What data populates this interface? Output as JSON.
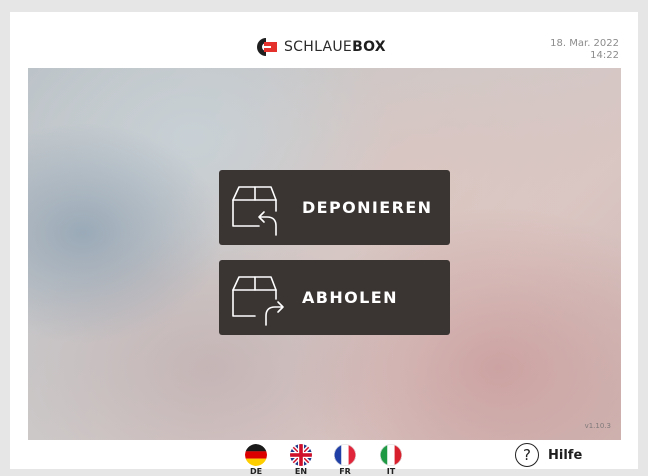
{
  "header": {
    "brand_prefix": "SCHLAUE",
    "brand_suffix": "BOX",
    "date": "18. Mar. 2022",
    "time": "14:22"
  },
  "actions": {
    "deposit_label": "DEPONIEREN",
    "pickup_label": "ABHOLEN"
  },
  "version": "v1.10.3",
  "languages": [
    {
      "code": "DE",
      "flag_icon": "germany-flag-icon"
    },
    {
      "code": "EN",
      "flag_icon": "uk-flag-icon"
    },
    {
      "code": "FR",
      "flag_icon": "france-flag-icon"
    },
    {
      "code": "IT",
      "flag_icon": "italy-flag-icon"
    }
  ],
  "help": {
    "icon": "?",
    "label": "Hilfe"
  },
  "colors": {
    "button_bg": "#3a3533",
    "logo_red": "#e4312b",
    "logo_dark": "#1f1f1f"
  }
}
